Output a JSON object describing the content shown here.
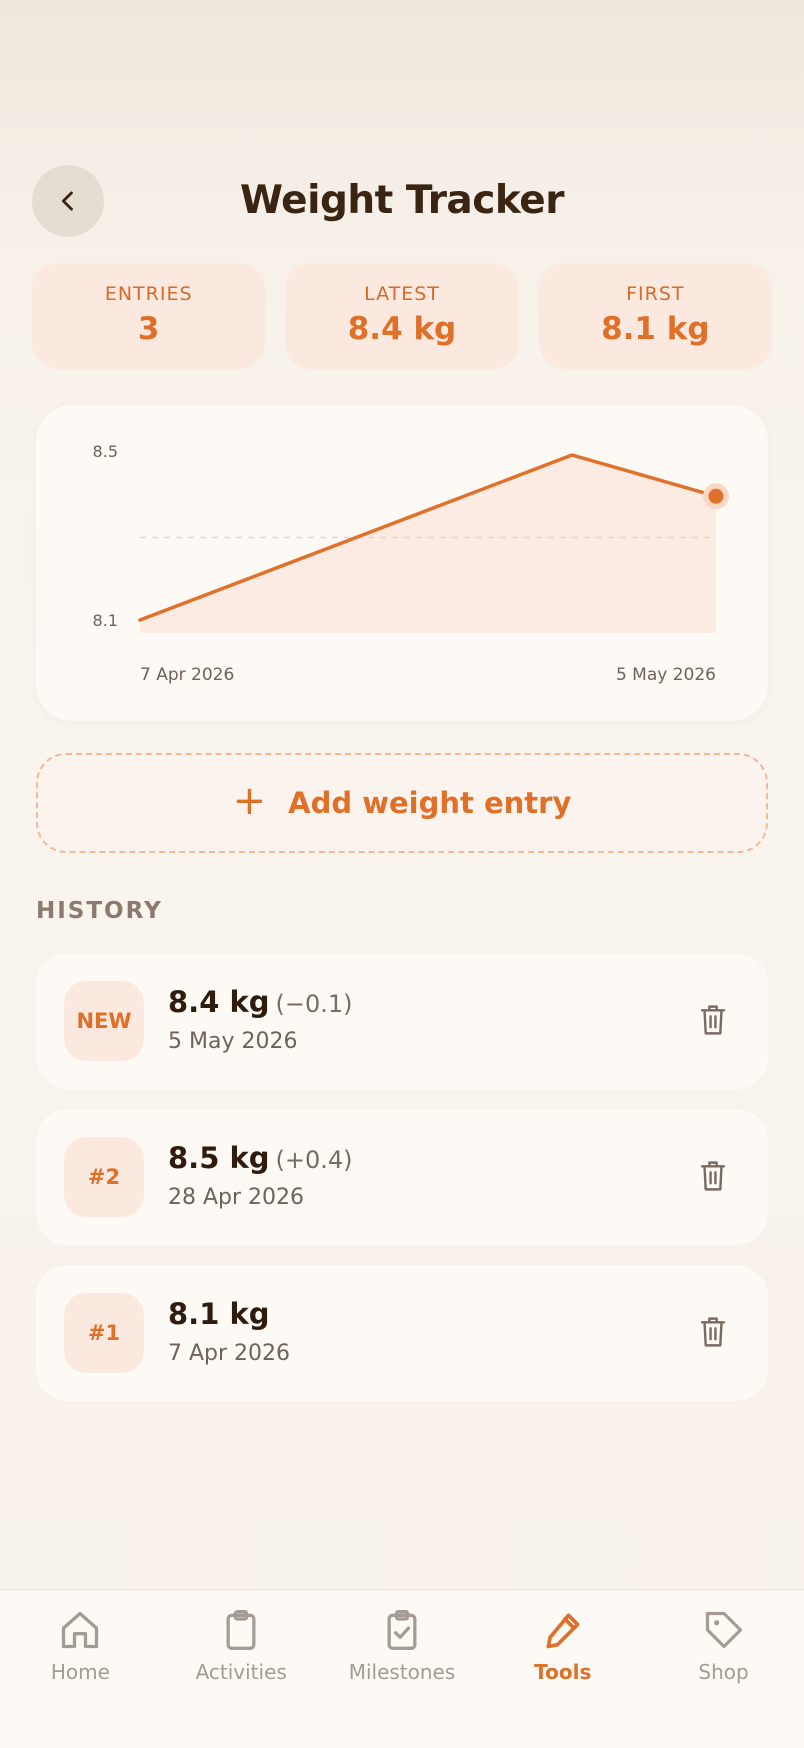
{
  "header": {
    "title": "Weight Tracker"
  },
  "stats": [
    {
      "label": "ENTRIES",
      "value": "3"
    },
    {
      "label": "LATEST",
      "value": "8.4 kg"
    },
    {
      "label": "FIRST",
      "value": "8.1 kg"
    }
  ],
  "chart_data": {
    "type": "area",
    "x": [
      "7 Apr 2026",
      "28 Apr 2026",
      "5 May 2026"
    ],
    "values": [
      8.1,
      8.5,
      8.4
    ],
    "y_ticks": [
      "8.5",
      "8.1"
    ],
    "x_tick_labels": [
      "7 Apr 2026",
      "5 May 2026"
    ],
    "ylim": [
      8.1,
      8.5
    ],
    "reference_line": 8.3,
    "grid": false,
    "colors": {
      "line": "#e0702a",
      "fill": "#fcebe2"
    }
  },
  "add_button": {
    "label": "Add weight entry"
  },
  "history": {
    "title": "HISTORY",
    "entries": [
      {
        "badge": "NEW",
        "weight": "8.4 kg",
        "delta": "(−0.1)",
        "date": "5 May 2026"
      },
      {
        "badge": "#2",
        "weight": "8.5 kg",
        "delta": "(+0.4)",
        "date": "28 Apr 2026"
      },
      {
        "badge": "#1",
        "weight": "8.1 kg",
        "delta": "",
        "date": "7 Apr 2026"
      }
    ]
  },
  "nav": {
    "items": [
      {
        "label": "Home",
        "icon": "home-icon"
      },
      {
        "label": "Activities",
        "icon": "clipboard-icon"
      },
      {
        "label": "Milestones",
        "icon": "clipboard-check-icon"
      },
      {
        "label": "Tools",
        "icon": "pencil-icon",
        "active": true
      },
      {
        "label": "Shop",
        "icon": "tag-icon"
      }
    ]
  },
  "colors": {
    "accent": "#e06f27",
    "badge_bg": "#fbe9df"
  }
}
